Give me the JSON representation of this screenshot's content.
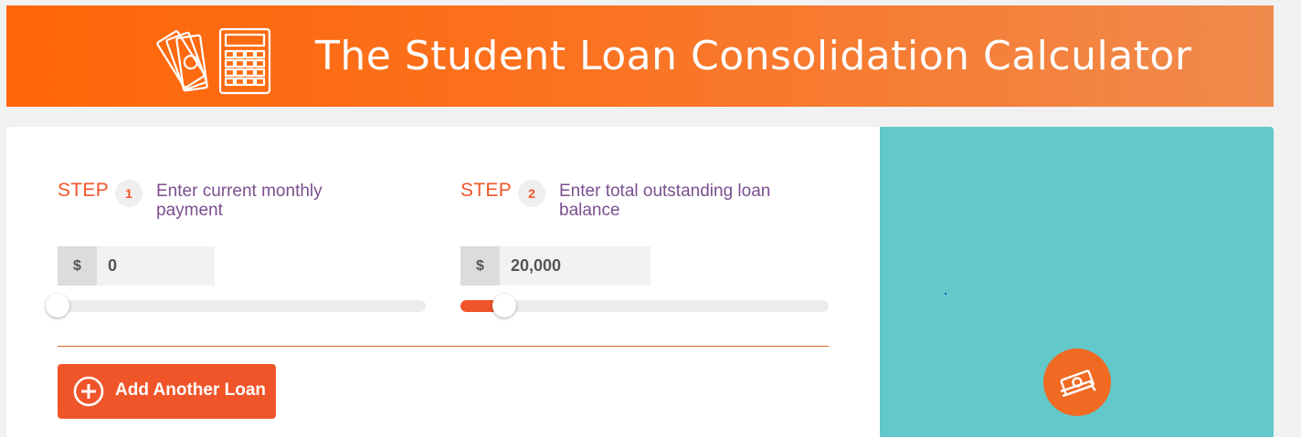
{
  "header": {
    "title": "The Student Loan Consolidation Calculator",
    "icon": "money-calculator-icon"
  },
  "steps": [
    {
      "word": "STEP",
      "number": "1",
      "description": "Enter current monthly payment",
      "prefix": "$",
      "value": "0",
      "slider_fraction": 0
    },
    {
      "word": "STEP",
      "number": "2",
      "description": "Enter total outstanding loan balance",
      "prefix": "$",
      "value": "20,000",
      "slider_fraction": 0.12
    }
  ],
  "add_loan_button": {
    "label": "Add Another Loan",
    "icon": "plus-circle-icon"
  },
  "side_panel": {
    "badge_icon": "money-icon"
  },
  "colors": {
    "header_start": "#ff6608",
    "header_end": "#f08a4c",
    "accent": "#f0552a",
    "step_text": "#7b4f8f",
    "side_panel": "#62c8c9"
  }
}
